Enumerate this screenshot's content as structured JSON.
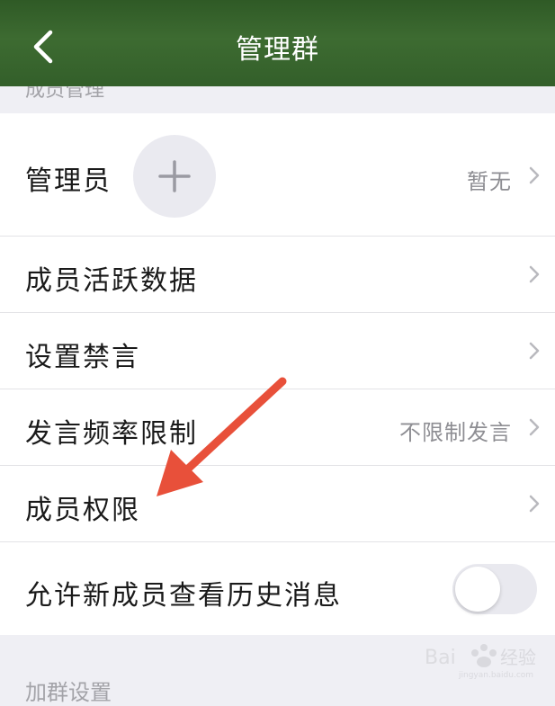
{
  "nav": {
    "title": "管理群",
    "back_icon": "chevron-left-icon",
    "background": "#3a6630"
  },
  "sections": {
    "top_header": "成员管理",
    "bottom_header": "加群设置"
  },
  "rows": [
    {
      "label": "管理员",
      "value": "暂无"
    },
    {
      "label": "成员活跃数据",
      "value": ""
    },
    {
      "label": "设置禁言",
      "value": ""
    },
    {
      "label": "发言频率限制",
      "value": "不限制发言"
    },
    {
      "label": "成员权限",
      "value": ""
    },
    {
      "label": "允许新成员查看历史消息",
      "value": ""
    }
  ],
  "toggle": {
    "on": false
  },
  "annotation": {
    "arrow_color": "#e8503a"
  },
  "watermark": {
    "brand": "Baidu",
    "sub": "经验",
    "url": "jingyan.baidu.com"
  }
}
